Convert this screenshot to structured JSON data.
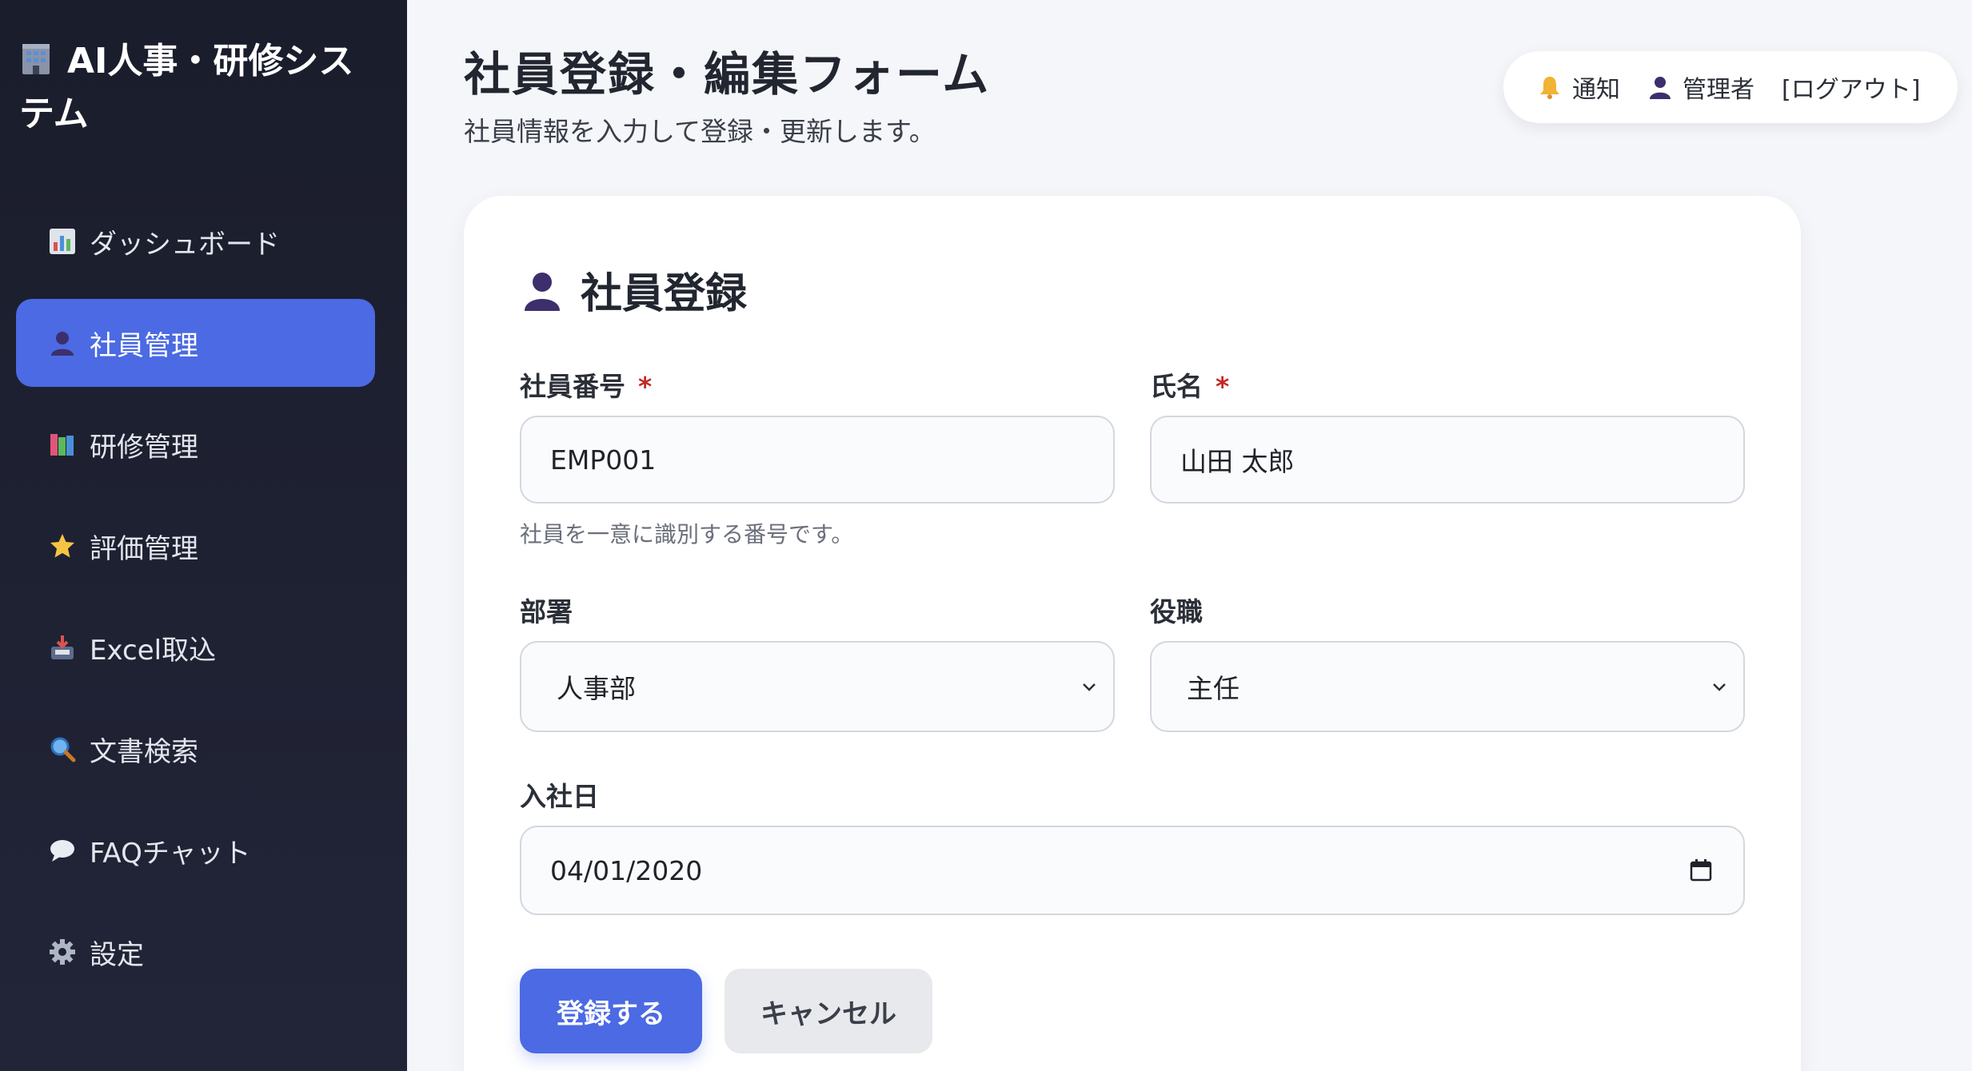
{
  "sidebar": {
    "brand": "AI人事・研修システム",
    "items": [
      {
        "label": "ダッシュボード",
        "icon": "bar-chart-icon"
      },
      {
        "label": "社員管理",
        "icon": "person-icon",
        "active": true
      },
      {
        "label": "研修管理",
        "icon": "books-icon"
      },
      {
        "label": "評価管理",
        "icon": "star-icon"
      },
      {
        "label": "Excel取込",
        "icon": "inbox-tray-icon"
      },
      {
        "label": "文書検索",
        "icon": "magnifier-icon"
      },
      {
        "label": "FAQチャット",
        "icon": "speech-bubble-icon"
      },
      {
        "label": "設定",
        "icon": "gear-icon"
      }
    ]
  },
  "header": {
    "title": "社員登録・編集フォーム",
    "subtitle": "社員情報を入力して登録・更新します。"
  },
  "userbar": {
    "notify": "通知",
    "admin": "管理者",
    "logout": "[ログアウト]"
  },
  "form": {
    "title": "社員登録",
    "required_mark": "*",
    "employee_id": {
      "label": "社員番号",
      "value": "EMP001",
      "hint": "社員を一意に識別する番号です。"
    },
    "name": {
      "label": "氏名",
      "value": "山田 太郎"
    },
    "department": {
      "label": "部署",
      "value": "人事部"
    },
    "position": {
      "label": "役職",
      "value": "主任"
    },
    "hire_date": {
      "label": "入社日",
      "value": "04/01/2020"
    },
    "submit": "登録する",
    "cancel": "キャンセル"
  },
  "colors": {
    "accent": "#4b6ae3",
    "sidebar_bg": "#1a1d2b",
    "required": "#c62828"
  }
}
